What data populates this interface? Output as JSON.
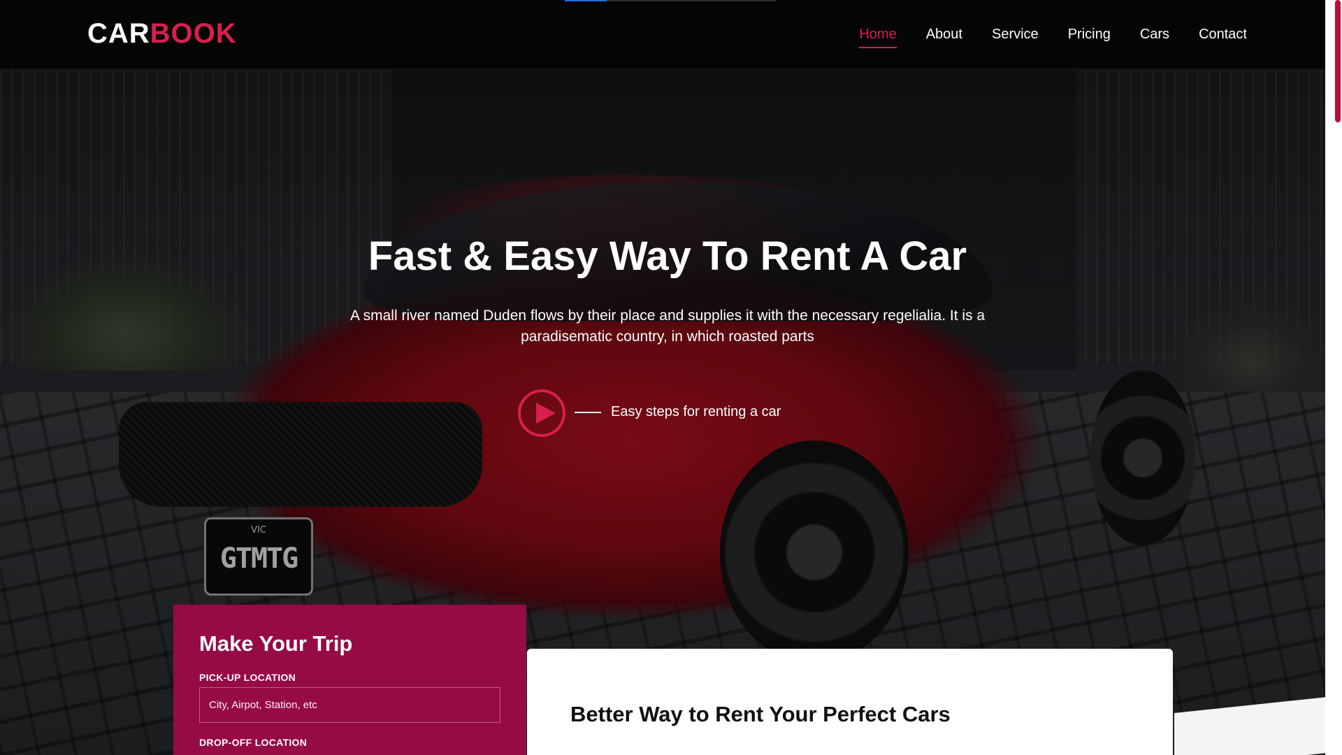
{
  "brand": {
    "part1": "CAR",
    "part2": "BOOK"
  },
  "nav": {
    "items": [
      {
        "label": "Home",
        "active": true
      },
      {
        "label": "About",
        "active": false
      },
      {
        "label": "Service",
        "active": false
      },
      {
        "label": "Pricing",
        "active": false
      },
      {
        "label": "Cars",
        "active": false
      },
      {
        "label": "Contact",
        "active": false
      }
    ]
  },
  "hero": {
    "title": "Fast & Easy Way To Rent A Car",
    "subtitle": "A small river named Duden flows by their place and supplies it with the necessary regelialia. It is a paradisematic country, in which roasted parts",
    "video_label": "Easy steps for renting a car"
  },
  "plate": {
    "state": "VIC",
    "number": "GTMTG"
  },
  "trip": {
    "title": "Make Your Trip",
    "pickup_label": "PICK-UP LOCATION",
    "pickup_placeholder": "City, Airpot, Station, etc",
    "dropoff_label": "DROP-OFF LOCATION"
  },
  "card": {
    "title": "Better Way to Rent Your Perfect Cars"
  },
  "colors": {
    "accent": "#d81f4f",
    "form_bg": "#960b46",
    "nav_bg": "#050505"
  }
}
